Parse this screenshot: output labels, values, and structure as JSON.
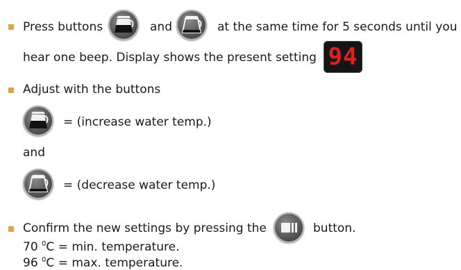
{
  "steps": {
    "s1_a": "Press buttons",
    "s1_and": "and",
    "s1_b": "at the same time for 5 seconds until you",
    "s1_c": "hear one beep. Display shows the present setting",
    "display_value": "94",
    "s2": "Adjust with the buttons",
    "increase": "= (increase water temp.)",
    "and": "and",
    "decrease": "= (decrease water temp.)",
    "s3_a": "Confirm the new settings by pressing the",
    "s3_b": "button.",
    "min_value": "70",
    "min_deg": "0",
    "min_text": "C = min. temperature.",
    "max_value": "96",
    "max_deg": "0",
    "max_text": "C = max. temperature."
  },
  "icons": {
    "increase_button": "coffee-pot-full-icon",
    "decrease_button": "coffee-pot-empty-icon",
    "confirm_button": "stop-pause-icon"
  },
  "colors": {
    "bullet": "#d9a64a",
    "display_digits": "#e0201c"
  }
}
